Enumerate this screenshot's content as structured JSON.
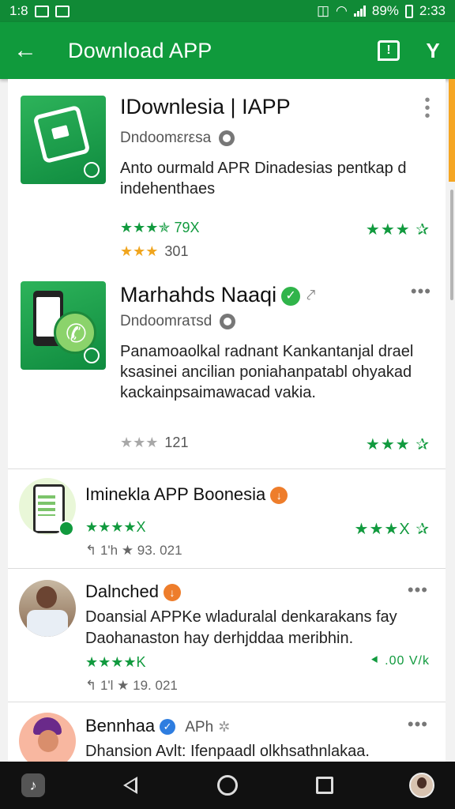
{
  "status_bar": {
    "time_left": "1:8",
    "battery": "89%",
    "time_right": "2:33"
  },
  "app_bar": {
    "title": "Download APP"
  },
  "cards": [
    {
      "name": "IDownlesia | IAPP",
      "developer": "Dndoomεrεsa",
      "description": "Anto ourmald APR Dinadesias pentkap d indehenthaes",
      "left_rating": "★★★✯ 79X",
      "sub_rating": "★★★",
      "sub_count": "301",
      "right_rating": "★★★ ✰"
    },
    {
      "name": "Marhahds Naaqi",
      "developer": "Dndoomraτsd",
      "description": "Panamoaolkal radnant Kankantanjal drael ksasinei ancilian poniahanpatabl ohyakad kackainpsaimawacad vakia.",
      "sub_rating": "★★★",
      "sub_count": "121",
      "right_rating": "★★★ ✰"
    }
  ],
  "list_items": [
    {
      "title": "Iminekla APP Boonesia",
      "ratings": "★★★★X",
      "right_rating": "★★★X ✰",
      "meta": "↰ 1'h ★ 93. 021"
    },
    {
      "title": "Dalnched",
      "description": "Doansial APPKe wladuralal denkarakans fay Daohanaston hay derhjddaa meribhin.",
      "ratings": "★★★★K",
      "right_rating": "⯇ .00 V/k",
      "meta": "↰ 1'l ★ 19. 021"
    },
    {
      "title": "Bennhaa",
      "title_suffix": "APh",
      "description": "Dhansion Avlt: Ifenpaadl olkhsathnlakaa."
    }
  ],
  "colors": {
    "brand_green": "#109a3c",
    "accent_orange": "#f5a623"
  }
}
